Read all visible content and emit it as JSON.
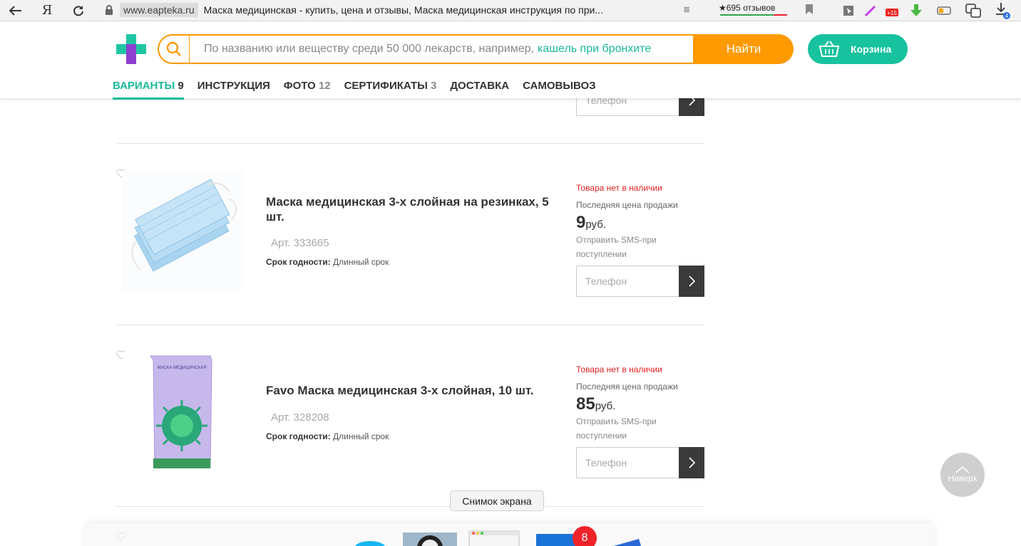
{
  "browser": {
    "domain": "www.eapteka.ru",
    "page_title": "Маска медицинская - купить, цена и отзывы, Маска медицинская инструкция по при...",
    "reviews": "★695 отзывов",
    "ext_badge": "+15",
    "downloads_badge": "4"
  },
  "header": {
    "search_placeholder": "По названию или веществу среди 50 000 лекарств, например,",
    "search_hint": "кашель при бронхите",
    "search_button": "Найти",
    "cart_label": "Корзина"
  },
  "tabs": [
    {
      "label": "ВАРИАНТЫ",
      "count": "9",
      "active": true
    },
    {
      "label": "ИНСТРУКЦИЯ",
      "count": ""
    },
    {
      "label": "ФОТО",
      "count": "12"
    },
    {
      "label": "СЕРТИФИКАТЫ",
      "count": "3"
    },
    {
      "label": "ДОСТАВКА",
      "count": ""
    },
    {
      "label": "САМОВЫВОЗ",
      "count": ""
    }
  ],
  "products": [
    {
      "title": "Маска медицинская 3-х слойная на резинках, 5 шт.",
      "sku": "Арт. 333665",
      "shelf_label": "Срок годности:",
      "shelf_value": "Длинный срок",
      "availability": "Товара нет в наличии",
      "last_price_label": "Последняя цена продажи",
      "price": "9",
      "currency": "руб.",
      "sms": "Отправить SMS-при поступлении",
      "phone_placeholder": "Телефон"
    },
    {
      "title": "Favo Маска медицинская 3-х слойная, 10 шт.",
      "sku": "Арт. 328208",
      "shelf_label": "Срок годности:",
      "shelf_value": "Длинный срок",
      "availability": "Товара нет в наличии",
      "last_price_label": "Последняя цена продажи",
      "price": "85",
      "currency": "руб.",
      "sms": "Отправить SMS-при поступлении",
      "phone_placeholder": "Телефон"
    }
  ],
  "partial_product": {
    "phone_placeholder": "Телефон"
  },
  "package_text": "МАСКА МЕДИЦИНСКАЯ",
  "up_button": "Наверх",
  "tooltip": "Снимок экрана",
  "dock_badge": "8",
  "colors": {
    "accent": "#17b99a",
    "search_orange": "#ff9a00",
    "cart_green": "#17c29e",
    "out_of_stock": "#e02020"
  }
}
